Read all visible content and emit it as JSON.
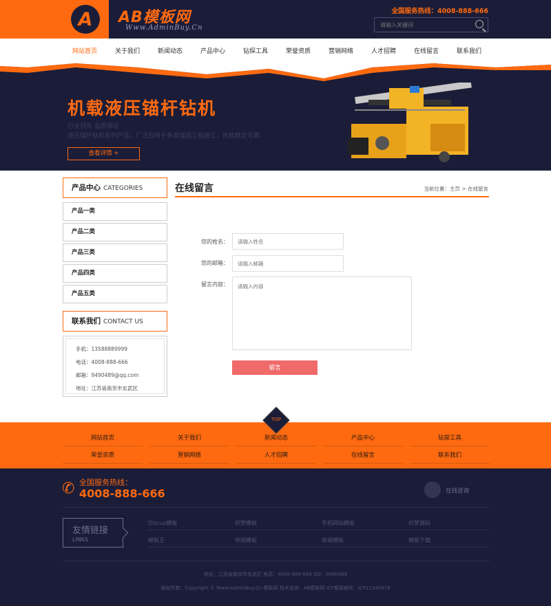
{
  "header": {
    "logo_letter": "A",
    "logo_text": "AB模板网",
    "logo_sub": "Www.AdminBuy.Cn",
    "hotline": "全国服务热线：4008-888-666",
    "search_placeholder": "请输入关键词"
  },
  "nav": [
    "网站首页",
    "关于我们",
    "新闻动态",
    "产品中心",
    "钻探工具",
    "荣誉资质",
    "营销网络",
    "人才招聘",
    "在线留言",
    "联系我们"
  ],
  "banner": {
    "title": "机载液压锚杆钻机",
    "sub1": "行业领先 品质保证",
    "sub2": "液压锚杆钻机系列产品，广泛应用于各类锚固工程施工，性能稳定可靠",
    "button": "查看详情 +"
  },
  "sidebar": {
    "cat_title": "产品中心",
    "cat_title_en": "CATEGORIES",
    "categories": [
      "产品一类",
      "产品二类",
      "产品三类",
      "产品四类",
      "产品五类"
    ],
    "contact_title": "联系我们",
    "contact_title_en": "CONTACT US",
    "contact": [
      "手机：13588889999",
      "电话：4008-888-666",
      "邮箱：9490489@qq.com",
      "地址：江苏省南京市玄武区"
    ]
  },
  "main": {
    "title": "在线留言",
    "crumb_prefix": "当前位置：",
    "crumb_home": "主页",
    "crumb_sep": " > ",
    "crumb_current": "在线留言",
    "form": {
      "name_label": "您的姓名：",
      "name_placeholder": "请输入姓名",
      "email_label": "您的邮箱：",
      "email_placeholder": "请输入邮箱",
      "content_label": "留言内容：",
      "content_placeholder": "请输入内容",
      "submit": "留言"
    }
  },
  "footnav": {
    "top": "TOP",
    "row1": [
      "网站首页",
      "关于我们",
      "新闻动态",
      "产品中心",
      "钻探工具"
    ],
    "row2": [
      "荣誉资质",
      "营销网络",
      "人才招聘",
      "在线留言",
      "联系我们"
    ]
  },
  "footer": {
    "hotline_label": "全国服务热线：",
    "hotline_number": "4008-888-666",
    "consult": "在线咨询",
    "links_cn": "友情链接",
    "links_en": "LINKS",
    "links": [
      "Discuz模板",
      "织梦模板",
      "手机网站模板",
      "织梦源码",
      "模板王",
      "帝国模板",
      "商城模板",
      "模板下载"
    ],
    "address_line": "地址：江苏省南京市玄武区    电话：4008-888-666    QQ：9490489",
    "copyright_line": "版权所有：Copyright © Www.AdminBuy.Cn 模板网    技术支持：AB模板网    ICP备案编号：ICP12345678"
  },
  "colors": {
    "accent": "#ff6a10",
    "dark": "#1b1d38",
    "submit": "#f06a6a"
  }
}
